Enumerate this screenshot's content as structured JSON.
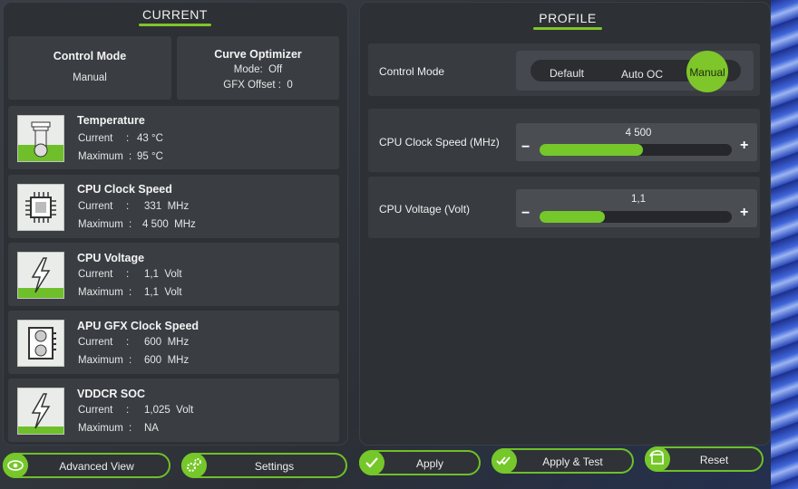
{
  "current": {
    "title": "CURRENT",
    "control_mode": {
      "label": "Control Mode",
      "value": "Manual"
    },
    "curve_optimizer": {
      "label": "Curve Optimizer",
      "mode": "Mode:  Off",
      "gfx_offset": "GFX Offset :  0"
    },
    "metrics": [
      {
        "title": "Temperature",
        "current_label": "Current",
        "current": "43 °C",
        "max_label": "Maximum",
        "max": "95 °C",
        "icon": "thermometer-icon",
        "fill": 0.5
      },
      {
        "title": "CPU Clock Speed",
        "current_label": "Current",
        "current": "331  MHz",
        "max_label": "Maximum",
        "max": "4 500  MHz",
        "icon": "cpu-chip-icon",
        "fill": 0.0
      },
      {
        "title": "CPU Voltage",
        "current_label": "Current",
        "current": "1,1  Volt",
        "max_label": "Maximum",
        "max": "1,1  Volt",
        "icon": "lightning-icon",
        "fill": 0.3
      },
      {
        "title": "APU GFX Clock Speed",
        "current_label": "Current",
        "current": "600  MHz",
        "max_label": "Maximum",
        "max": "600  MHz",
        "icon": "graphics-card-icon",
        "fill": 0.0
      },
      {
        "title": "VDDCR SOC",
        "current_label": "Current",
        "current": "1,025  Volt",
        "max_label": "Maximum",
        "max": "NA",
        "icon": "lightning-icon",
        "fill": 0.15
      }
    ]
  },
  "profile": {
    "title": "PROFILE",
    "control_mode": {
      "label": "Control Mode",
      "options": [
        "Default",
        "Auto OC",
        "Manual"
      ],
      "selected": "Manual"
    },
    "cpu_clock": {
      "label": "CPU Clock Speed (MHz)",
      "value": "4 500",
      "fraction": 0.54,
      "minus": "−",
      "plus": "+"
    },
    "cpu_voltage": {
      "label": "CPU Voltage (Volt)",
      "value": "1,1",
      "fraction": 0.34,
      "minus": "−",
      "plus": "+"
    }
  },
  "buttons": {
    "advanced_view": "Advanced View",
    "settings": "Settings",
    "apply": "Apply",
    "apply_test": "Apply & Test",
    "reset": "Reset"
  },
  "colors": {
    "accent": "#76c72a",
    "panel": "#2d3035",
    "card": "#3a3d42"
  }
}
